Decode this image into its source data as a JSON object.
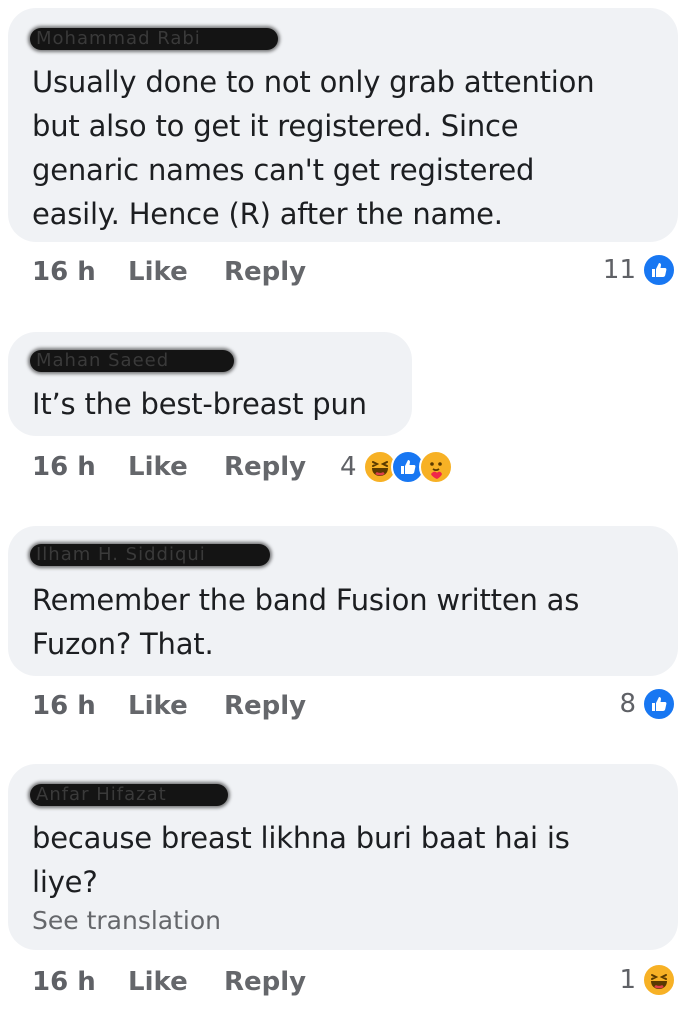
{
  "comments": [
    {
      "author": "Mohammad Rabi",
      "text": "Usually done to not only grab attention\nbut also to get it registered. Since\ngenaric names can't get registered\neasily. Hence (R) after the name.",
      "time": "16 h",
      "like_label": "Like",
      "reply_label": "Reply",
      "reaction_count": "11",
      "reactions": [
        "like-icon"
      ]
    },
    {
      "author": "Mahan Saeed",
      "text": "It’s the best-breast pun",
      "time": "16 h",
      "like_label": "Like",
      "reply_label": "Reply",
      "reaction_count": "4",
      "reactions": [
        "haha-icon",
        "like-icon",
        "care-icon"
      ]
    },
    {
      "author": "Ilham H. Siddiqui",
      "text": "Remember the band Fusion written as\nFuzon? That.",
      "time": "16 h",
      "like_label": "Like",
      "reply_label": "Reply",
      "reaction_count": "8",
      "reactions": [
        "like-icon"
      ]
    },
    {
      "author": "Anfar Hifazat",
      "text": "because breast likhna buri baat hai is\nliye?",
      "see_translation": "See translation",
      "time": "16 h",
      "like_label": "Like",
      "reply_label": "Reply",
      "reaction_count": "1",
      "reactions": [
        "haha-icon"
      ]
    }
  ],
  "colors": {
    "bubble": "#f0f2f5",
    "text": "#1c1e21",
    "meta": "#65676b",
    "like_blue": "#1877f2",
    "haha_yellow": "#f7b125"
  }
}
